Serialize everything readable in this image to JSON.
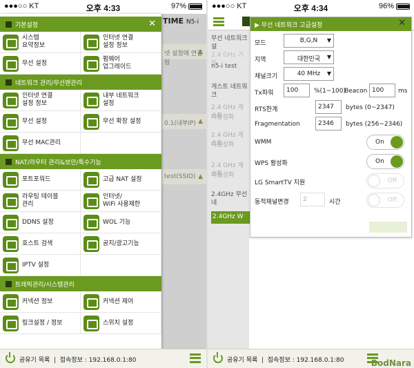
{
  "left_status": {
    "carrier": "●●●○○ KT",
    "time": "오후 4:33",
    "battery": "97%",
    "battery_level": 0.97
  },
  "right_status": {
    "carrier": "●●●○○ KT",
    "time": "오후 4:34",
    "battery": "96%",
    "battery_level": 0.96
  },
  "left_bg": {
    "brand": "TIME",
    "model": "N5-i",
    "rows": [
      "넷 설정에 연결됨",
      "0.1(내부IP)",
      "test(SSID)"
    ]
  },
  "drawer": {
    "sections": [
      {
        "title": "기본설정",
        "items": [
          {
            "label": "시스템\n요약정보",
            "icon": "system-summary-icon"
          },
          {
            "label": "인터넷 연결\n설정 정보",
            "icon": "internet-connection-icon"
          },
          {
            "label": "무선 설정",
            "icon": "wifi-icon"
          },
          {
            "label": "펌웨어\n업그레이드",
            "icon": "firmware-upgrade-icon"
          }
        ]
      },
      {
        "title": "네트워크 관리/무선랜관리",
        "items": [
          {
            "label": "인터넷 연결\n설정 정보",
            "icon": "internet-connection-icon"
          },
          {
            "label": "내부 네트워크\n설정",
            "icon": "internal-network-icon"
          },
          {
            "label": "무선 설정",
            "icon": "wifi-icon"
          },
          {
            "label": "무선 확장 설정",
            "icon": "wifi-extend-icon"
          },
          {
            "label": "무선 MAC관리",
            "icon": "mac-icon"
          },
          {
            "label": "",
            "icon": ""
          }
        ]
      },
      {
        "title": "NAT/라우터 관리&보안/특수기능",
        "items": [
          {
            "label": "포트포워드",
            "icon": "port-forward-icon"
          },
          {
            "label": "고급 NAT 설정",
            "icon": "advanced-nat-icon"
          },
          {
            "label": "라우팅 테이블\n관리",
            "icon": "routing-table-icon"
          },
          {
            "label": "인터넷/\nWiFi 사용제한",
            "icon": "usage-limit-icon"
          },
          {
            "label": "DDNS 설정",
            "icon": "ddns-icon"
          },
          {
            "label": "WOL 기능",
            "icon": "wol-icon"
          },
          {
            "label": "호스트 검색",
            "icon": "host-search-icon"
          },
          {
            "label": "공지/광고기능",
            "icon": "notice-icon"
          },
          {
            "label": "IPTV 설정",
            "icon": "iptv-icon"
          },
          {
            "label": "",
            "icon": ""
          }
        ]
      },
      {
        "title": "트래픽관리/시스템관리",
        "items": [
          {
            "label": "커넥션 정보",
            "icon": "connection-info-icon"
          },
          {
            "label": "커넥션 제어",
            "icon": "connection-control-icon"
          },
          {
            "label": "링크설정 / 정보",
            "icon": "link-settings-icon"
          },
          {
            "label": "스위치 설정",
            "icon": "switch-settings-icon"
          }
        ]
      }
    ]
  },
  "bottom": {
    "router_list": "공유기 목록",
    "connection_info": "접속정보 : 192.168.0.1:80"
  },
  "right_bg": {
    "items": [
      "무선 네트워크 설",
      "2.4 GHz 기본",
      "n5-i test",
      "게스트 네트워크",
      "2.4 GHz 게스트",
      "비활성화",
      "2.4 GHz 게스트",
      "비활성화",
      "2.4 GHz 게스트",
      "비활성화",
      "2.4GHz 무선 네"
    ],
    "button": "2.4GHz W"
  },
  "advanced_panel": {
    "title": "무선 네트워크 고급설정",
    "mode": {
      "label": "모드",
      "value": "B,G,N"
    },
    "region": {
      "label": "지역",
      "value": "대한민국"
    },
    "channel_width": {
      "label": "채널크기",
      "value": "40 MHz"
    },
    "tx_power": {
      "label": "Tx파워",
      "value": "100",
      "unit": "%(1~100)",
      "beacon_label": "Beacon",
      "beacon_value": "100",
      "beacon_unit": "ms"
    },
    "rts": {
      "label": "RTS한계",
      "value": "2347",
      "unit": "bytes (0~2347)"
    },
    "fragmentation": {
      "label": "Fragmentation",
      "value": "2346",
      "unit": "bytes (256~2346)"
    },
    "wmm": {
      "label": "WMM",
      "state": "On"
    },
    "wps": {
      "label": "WPS 활성화",
      "state": "On"
    },
    "smarttv": {
      "label": "LG SmartTV 지원",
      "state": "Off"
    },
    "dynamic_channel": {
      "label": "동적채널변경",
      "value": "2",
      "unit": "시간",
      "state": "Off"
    }
  },
  "watermark": "BodNara",
  "colors": {
    "accent": "#6a9a1f",
    "dark": "#2a3a10"
  }
}
